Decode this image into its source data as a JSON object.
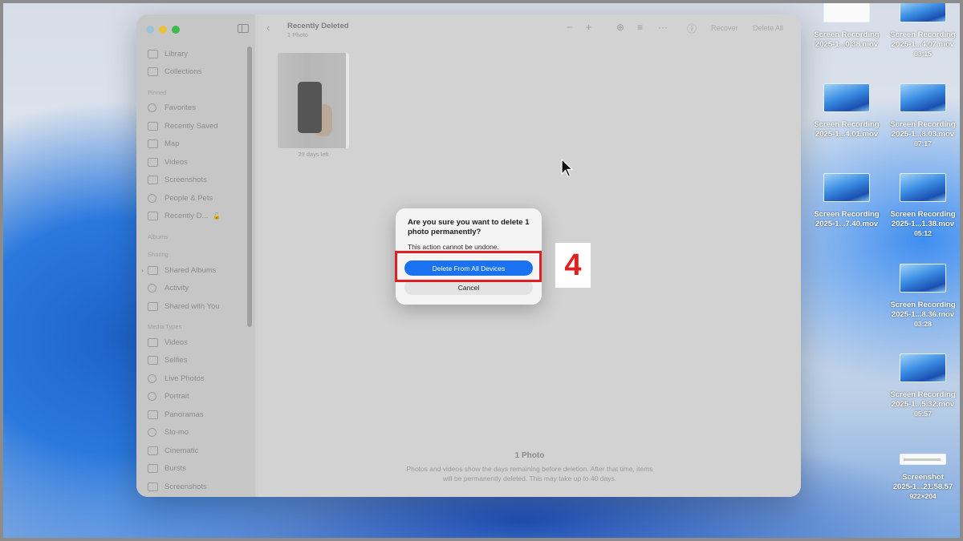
{
  "window": {
    "title": "Recently Deleted",
    "subtitle": "1 Photo",
    "actions": {
      "recover": "Recover",
      "delete_all": "Delete All"
    }
  },
  "sidebar": {
    "items_top": [
      {
        "label": "Library",
        "icon": "library-icon"
      },
      {
        "label": "Collections",
        "icon": "collections-icon"
      }
    ],
    "pinned_heading": "Pinned",
    "pinned": [
      {
        "label": "Favorites",
        "icon": "heart-icon"
      },
      {
        "label": "Recently Saved",
        "icon": "recently-saved-icon"
      },
      {
        "label": "Map",
        "icon": "map-icon"
      },
      {
        "label": "Videos",
        "icon": "video-icon"
      },
      {
        "label": "Screenshots",
        "icon": "screenshot-icon"
      },
      {
        "label": "People & Pets",
        "icon": "people-icon"
      },
      {
        "label": "Recently D...",
        "icon": "trash-icon"
      }
    ],
    "albums_heading": "Albums",
    "sharing_heading": "Sharing",
    "sharing": [
      {
        "label": "Shared Albums",
        "icon": "shared-albums-icon"
      },
      {
        "label": "Activity",
        "icon": "activity-icon"
      },
      {
        "label": "Shared with You",
        "icon": "shared-with-you-icon"
      }
    ],
    "media_heading": "Media Types",
    "media": [
      {
        "label": "Videos",
        "icon": "video-icon"
      },
      {
        "label": "Selfies",
        "icon": "selfie-icon"
      },
      {
        "label": "Live Photos",
        "icon": "live-photo-icon"
      },
      {
        "label": "Portrait",
        "icon": "portrait-icon"
      },
      {
        "label": "Panoramas",
        "icon": "panorama-icon"
      },
      {
        "label": "Slo-mo",
        "icon": "slomo-icon"
      },
      {
        "label": "Cinematic",
        "icon": "cinematic-icon"
      },
      {
        "label": "Bursts",
        "icon": "bursts-icon"
      },
      {
        "label": "Screenshots",
        "icon": "screenshot-icon"
      }
    ]
  },
  "content": {
    "photo_label": "29 days left",
    "footer_count": "1 Photo",
    "footer_line1": "Photos and videos show the days remaining before deletion. After that time, items",
    "footer_line2": "will be permanently deleted. This may take up to 40 days."
  },
  "dialog": {
    "title": "Are you sure you want to delete 1 photo permanently?",
    "message": "This action cannot be undone.",
    "primary": "Delete From All Devices",
    "cancel": "Cancel"
  },
  "annotation": {
    "step": "4",
    "color": "#e02020"
  },
  "desktop_icons": [
    {
      "name": "Screen Recording",
      "name2": "2025-1...0.38.mov",
      "meta": ""
    },
    {
      "name": "Screen Recording",
      "name2": "2025-1...4.07.mov",
      "meta": "03:15"
    },
    {
      "name": "Screen Recording",
      "name2": "2025-1...4.01.mov",
      "meta": ""
    },
    {
      "name": "Screen Recording",
      "name2": "2025-1...8.03.mov",
      "meta": "07:17"
    },
    {
      "name": "Screen Recording",
      "name2": "2025-1...7.40.mov",
      "meta": ""
    },
    {
      "name": "Screen Recording",
      "name2": "2025-1...1.38.mov",
      "meta": "05:12"
    },
    {
      "name": "Screen Recording",
      "name2": "2025-1...8.36.mov",
      "meta": "03:28"
    },
    {
      "name": "Screen Recording",
      "name2": "2025-1...5.32.mov",
      "meta": "05:57"
    },
    {
      "name": "Screenshot",
      "name2": "2025-1...21.58.57",
      "meta": "922×204"
    }
  ]
}
